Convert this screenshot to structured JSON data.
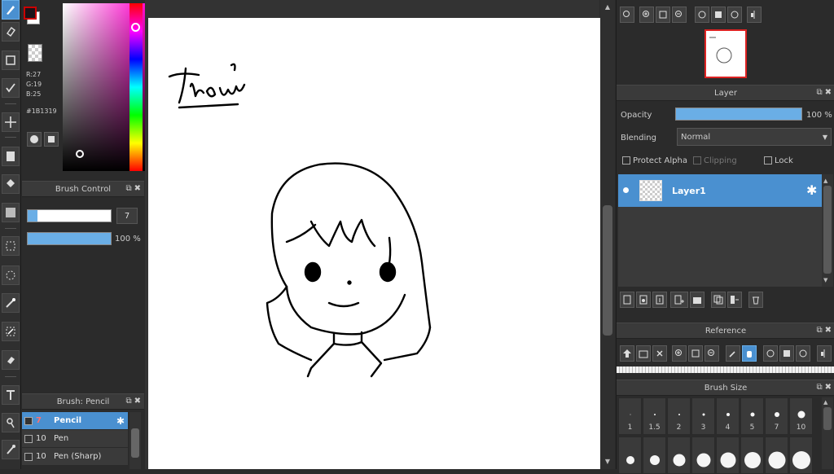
{
  "color_panel": {
    "r": "R:27",
    "g": "G:19",
    "b": "B:25",
    "hex": "#1B1319",
    "fg_color": "#1B1319",
    "bg_color": "#ffffff"
  },
  "brush_control": {
    "title": "Brush Control",
    "size_value": "7",
    "opacity_value": "100 %"
  },
  "brush_list": {
    "title": "Brush: Pencil",
    "items": [
      {
        "size": "7",
        "name": "Pencil"
      },
      {
        "size": "10",
        "name": "Pen"
      },
      {
        "size": "10",
        "name": "Pen (Sharp)"
      }
    ]
  },
  "layer_panel": {
    "title": "Layer",
    "opacity_label": "Opacity",
    "opacity_value": "100 %",
    "blending_label": "Blending",
    "blending_value": "Normal",
    "protect_alpha": "Protect Alpha",
    "clipping": "Clipping",
    "lock": "Lock",
    "layers": [
      {
        "name": "Layer1"
      }
    ]
  },
  "reference_panel": {
    "title": "Reference"
  },
  "brush_size_panel": {
    "title": "Brush Size",
    "sizes": [
      "1",
      "1.5",
      "2",
      "3",
      "4",
      "5",
      "7",
      "10"
    ]
  },
  "canvas": {
    "handwriting": "Thoai"
  },
  "colors": {
    "accent": "#4a90d0",
    "panel": "#2b2b2b",
    "header": "#3a3a3a"
  }
}
